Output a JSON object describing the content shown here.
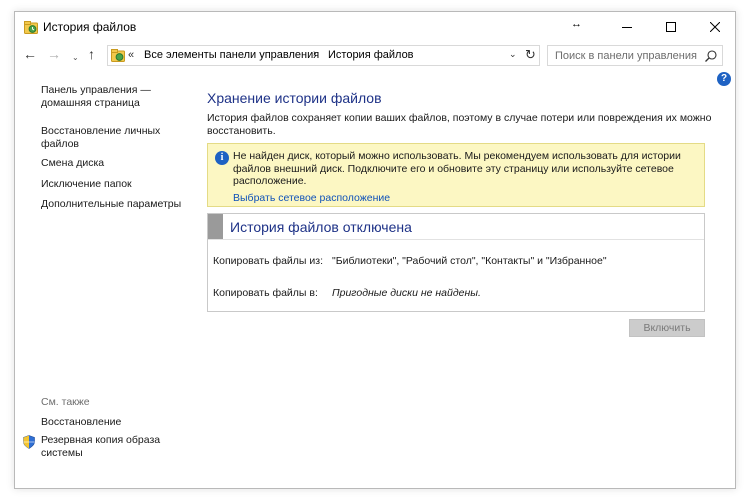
{
  "window": {
    "title": "История файлов",
    "resize_glyph": "↔"
  },
  "nav": {
    "back": "←",
    "forward": "→",
    "recent": "⌄",
    "up": "↑",
    "crumb_sep": "«",
    "crumb_1": "Все элементы панели управления",
    "crumb_chevron": "›",
    "crumb_2": "История файлов",
    "dropdown": "⌄",
    "refresh": "↻",
    "search_placeholder": "Поиск в панели управления"
  },
  "help": "?",
  "sidebar": {
    "home_link": [
      "Панель управления —",
      "домашняя страница"
    ],
    "restore_link": [
      "Восстановление личных",
      "файлов"
    ],
    "change_drive": "Смена диска",
    "exclude_folders": "Исключение папок",
    "advanced": "Дополнительные параметры",
    "see_also": "См. также",
    "recovery": "Восстановление",
    "system_image": [
      "Резервная копия образа",
      "системы"
    ]
  },
  "main": {
    "heading": "Хранение истории файлов",
    "description": "История файлов сохраняет копии ваших файлов, поэтому в случае потери или повреждения их можно восстановить.",
    "warning_icon": "i",
    "warning_text": "Не найден диск, который можно использовать. Мы рекомендуем использовать для истории файлов внешний диск. Подключите его и обновите эту страницу или используйте сетевое расположение.",
    "warning_link": "Выбрать сетевое расположение",
    "status_title": "История файлов отключена",
    "copy_from_label": "Копировать файлы из:",
    "copy_from_value": "\"Библиотеки\", \"Рабочий стол\", \"Контакты\" и \"Избранное\"",
    "copy_to_label": "Копировать файлы в:",
    "copy_to_value": "Пригодные диски не найдены.",
    "enable_button": "Включить"
  },
  "colors": {
    "heading": "#1e3287",
    "link": "#0f52b9",
    "warning_bg": "#fcf7c3",
    "info_blue": "#1e62c3"
  }
}
